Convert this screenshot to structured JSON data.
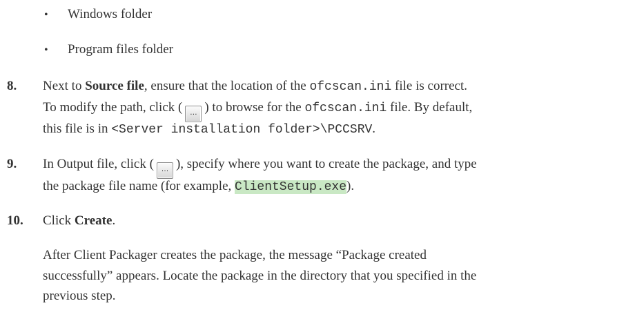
{
  "bullets": [
    "Windows folder",
    "Program files folder"
  ],
  "steps": [
    {
      "number": "8.",
      "lines": [
        [
          "Next to ",
          "Source file",
          ", ensure that the location of the ",
          "ofcscan.ini",
          " file is correct."
        ],
        [
          "To modify the path, click ",
          "…",
          " to browse for the ",
          "ofcscan.ini",
          " file. By default,"
        ],
        [
          "this file is in ",
          "<Server installation folder>\\PCCSRV",
          "."
        ]
      ]
    },
    {
      "number": "9.",
      "lines": [
        [
          "In Output file, click ",
          "…",
          ", specify where you want to create the package, and type"
        ],
        [
          "the package file name (for example, ",
          "ClientSetup.exe",
          ")."
        ]
      ]
    },
    {
      "number": "10.",
      "lines": [
        [
          "Click ",
          "Create",
          "."
        ]
      ]
    }
  ],
  "after_text": [
    "After Client Packager creates the package, the message “Package created",
    "successfully” appears. Locate the package in the directory that you specified in the",
    "previous step."
  ],
  "colors": {
    "text": "#333333",
    "highlight": "#c9e8c4"
  },
  "icons": {
    "browse_button": "browse-ellipsis-icon"
  }
}
